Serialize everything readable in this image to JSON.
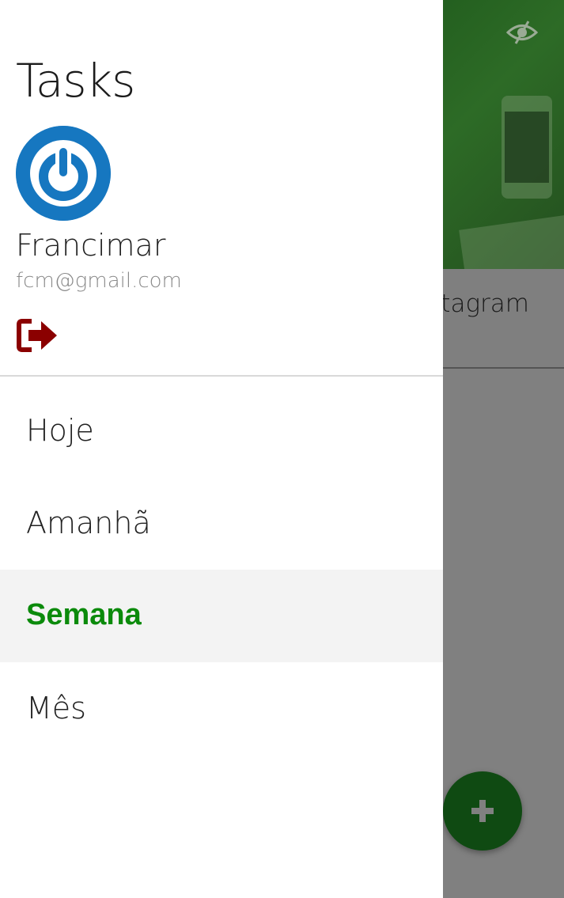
{
  "app": {
    "title": "Tasks"
  },
  "user": {
    "name": "Francimar",
    "email": "fcm@gmail.com",
    "avatar_icon": "power-icon",
    "avatar_color": "#1677c0"
  },
  "logout": {
    "icon": "sign-out-icon",
    "color": "#8b0000"
  },
  "menu": {
    "items": [
      {
        "label": "Hoje",
        "active": false
      },
      {
        "label": "Amanhã",
        "active": false
      },
      {
        "label": "Semana",
        "active": true
      },
      {
        "label": "Mês",
        "active": false
      }
    ],
    "active_color": "#0b8a0b"
  },
  "background": {
    "list_item_text": "stagram",
    "header_icon": "eye-slash-icon",
    "fab_icon": "plus-icon",
    "fab_color": "#0f4a12"
  }
}
